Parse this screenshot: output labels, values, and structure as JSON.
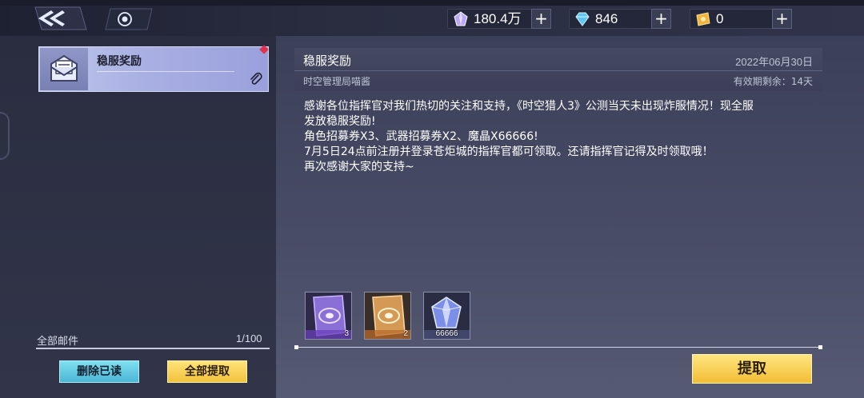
{
  "topbar": {
    "resources": [
      {
        "icon": "crystal-icon",
        "value": "180.4万",
        "plus": "+"
      },
      {
        "icon": "diamond-icon",
        "value": "846",
        "plus": "+"
      },
      {
        "icon": "gold-ticket-icon",
        "value": "0",
        "plus": "+"
      }
    ]
  },
  "mail_list": {
    "items": [
      {
        "title": "稳服奖励",
        "icon": "envelope-icon",
        "has_attachment": true,
        "unread": true
      }
    ],
    "count_label": "全部邮件",
    "count_value": "1/100",
    "delete_read_label": "删除已读",
    "claim_all_label": "全部提取"
  },
  "detail": {
    "title": "稳服奖励",
    "date": "2022年06月30日",
    "sender": "时空管理局喵酱",
    "validity": "有效期剩余：14天",
    "body_lines": [
      "感谢各位指挥官对我们热切的关注和支持，《时空猎人3》公测当天未出现炸服情况！现全服",
      "发放稳服奖励!",
      "角色招募券X3、武器招募券X2、魔晶X66666!",
      "7月5日24点前注册并登录苍炬城的指挥官都可领取。还请指挥官记得及时领取哦！",
      "再次感谢大家的支持~"
    ],
    "rewards": [
      {
        "name": "角色招募券",
        "icon": "character-recruit-ticket-icon",
        "qty": "3"
      },
      {
        "name": "武器招募券",
        "icon": "weapon-recruit-ticket-icon",
        "qty": "2"
      },
      {
        "name": "魔晶",
        "icon": "magic-crystal-icon",
        "qty": "66666"
      }
    ],
    "claim_label": "提取"
  },
  "colors": {
    "accent_yellow": "#f3bd35",
    "accent_cyan": "#4cb6d6",
    "unread_dot": "#e0304a"
  }
}
